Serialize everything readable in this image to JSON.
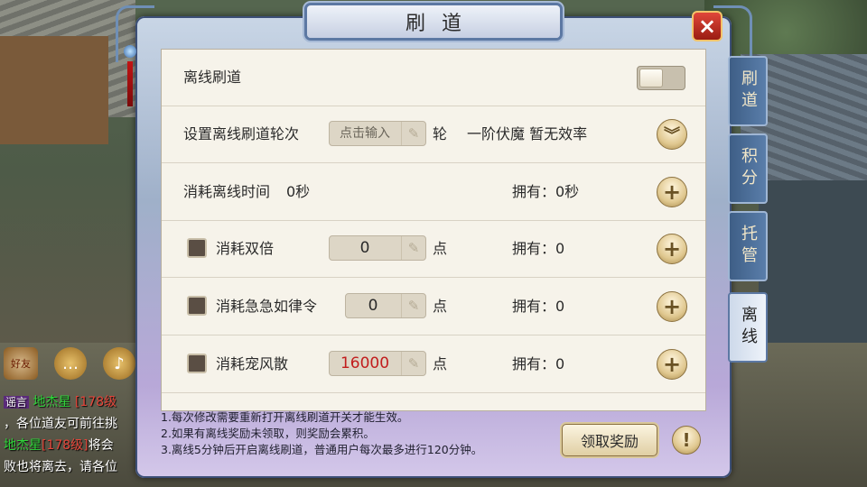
{
  "panel": {
    "title": "刷道",
    "close_icon": "×"
  },
  "rows": {
    "offline_label": "离线刷道",
    "rounds_label": "设置离线刷道轮次",
    "rounds_placeholder": "点击输入",
    "rounds_unit": "轮",
    "rounds_info": "一阶伏魔 暂无效率",
    "time_label": "消耗离线时间",
    "time_value": "0秒",
    "time_own": "拥有：0秒",
    "double_label": "消耗双倍",
    "double_value": "0",
    "double_unit": "点",
    "double_own": "拥有：0",
    "urgent_label": "消耗急急如律令",
    "urgent_value": "0",
    "urgent_unit": "点",
    "urgent_own": "拥有：0",
    "pet_label": "消耗宠风散",
    "pet_value": "16000",
    "pet_unit": "点",
    "pet_own": "拥有：0"
  },
  "notes": {
    "line1": "1.每次修改需要重新打开离线刷道开关才能生效。",
    "line2": "2.如果有离线奖励未领取，则奖励会累积。",
    "line3": "3.离线5分钟后开启离线刷道，普通用户每次最多进行120分钟。"
  },
  "buttons": {
    "reward": "领取奖励",
    "info": "!"
  },
  "tabs": [
    "刷道",
    "积分",
    "托管",
    "离线"
  ],
  "chat": {
    "friend_label": "好友",
    "lines": [
      {
        "tag": "谣言",
        "name": "地杰星",
        "level": "[178级",
        "text": ""
      },
      {
        "text": "，各位道友可前往挑"
      },
      {
        "name": "地杰星",
        "level": "[178级]",
        "text": "将会"
      },
      {
        "text": "败也将离去，请各位"
      }
    ]
  },
  "colors": {
    "accent_red": "#c21d1d",
    "tab_blue": "#3e5e86",
    "chat_green": "#2fd43a"
  }
}
